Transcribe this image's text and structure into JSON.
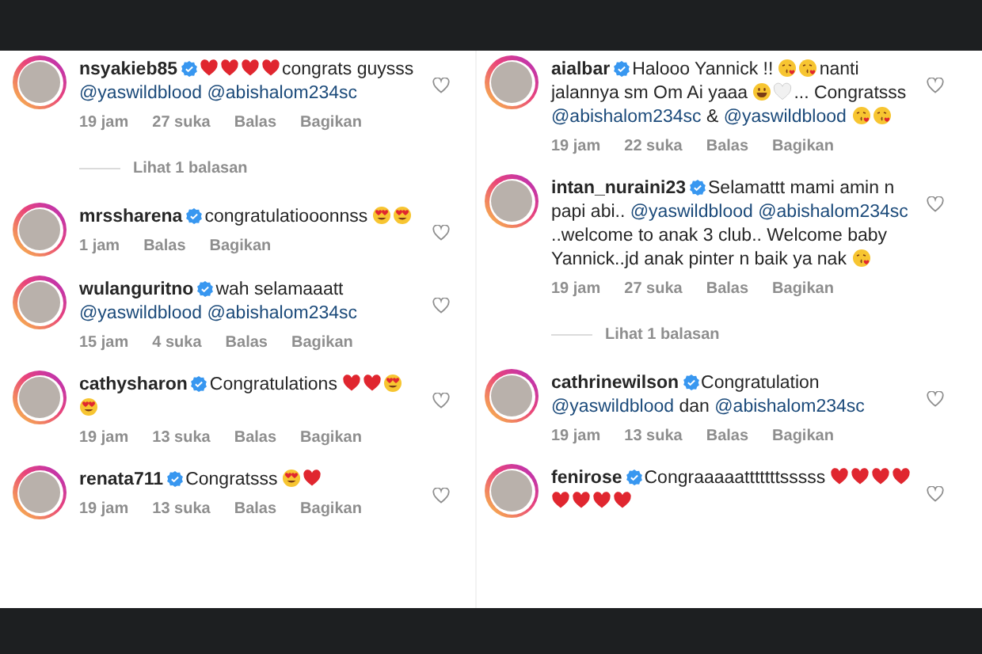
{
  "columns": [
    {
      "comments": [
        {
          "username": "nsyakieb85",
          "verified": true,
          "content": [
            {
              "kind": "heart"
            },
            {
              "kind": "heart"
            },
            {
              "kind": "heart"
            },
            {
              "kind": "heart"
            },
            {
              "kind": "text",
              "text": "congrats guysss"
            },
            {
              "kind": "mention",
              "text": "@yaswildblood"
            },
            {
              "kind": "mention",
              "text": "@abishalom234sc"
            }
          ],
          "time": "19 jam",
          "likes": "27 suka",
          "reply": "Balas",
          "share": "Bagikan",
          "replies": "Lihat 1 balasan"
        },
        {
          "username": "mrssharena",
          "verified": true,
          "content": [
            {
              "kind": "text",
              "text": "congratulatiooonnss"
            },
            {
              "kind": "heart-eyes"
            },
            {
              "kind": "heart-eyes"
            }
          ],
          "time": "1 jam",
          "reply": "Balas",
          "share": "Bagikan"
        },
        {
          "username": "wulanguritno",
          "verified": true,
          "content": [
            {
              "kind": "text",
              "text": "wah selamaaatt"
            },
            {
              "kind": "mention",
              "text": "@yaswildblood"
            },
            {
              "kind": "mention",
              "text": "@abishalom234sc"
            }
          ],
          "time": "15 jam",
          "likes": "4 suka",
          "reply": "Balas",
          "share": "Bagikan"
        },
        {
          "username": "cathysharon",
          "verified": true,
          "content": [
            {
              "kind": "text",
              "text": "Congratulations"
            },
            {
              "kind": "heart"
            },
            {
              "kind": "heart"
            },
            {
              "kind": "heart-eyes"
            },
            {
              "kind": "heart-eyes"
            }
          ],
          "time": "19 jam",
          "likes": "13 suka",
          "reply": "Balas",
          "share": "Bagikan"
        },
        {
          "username": "renata711",
          "verified": true,
          "content": [
            {
              "kind": "text",
              "text": "Congratsss"
            },
            {
              "kind": "heart-eyes"
            },
            {
              "kind": "heart"
            }
          ],
          "time": "19 jam",
          "likes": "13 suka",
          "reply": "Balas",
          "share": "Bagikan"
        }
      ]
    },
    {
      "comments": [
        {
          "username": "aialbar",
          "verified": true,
          "content": [
            {
              "kind": "text",
              "text": "Halooo Yannick !!"
            },
            {
              "kind": "kiss"
            },
            {
              "kind": "kiss"
            },
            {
              "kind": "text",
              "text": "nanti jalannya sm Om Ai yaaa"
            },
            {
              "kind": "smile"
            },
            {
              "kind": "white-heart"
            },
            {
              "kind": "text",
              "text": "... Congratsss"
            },
            {
              "kind": "mention",
              "text": "@abishalom234sc"
            },
            {
              "kind": "text",
              "text": "&"
            },
            {
              "kind": "mention",
              "text": "@yaswildblood"
            },
            {
              "kind": "kiss"
            },
            {
              "kind": "kiss"
            }
          ],
          "time": "19 jam",
          "likes": "22 suka",
          "reply": "Balas",
          "share": "Bagikan"
        },
        {
          "username": "intan_nuraini23",
          "verified": true,
          "content": [
            {
              "kind": "text",
              "text": "Selamattt mami amin n papi abi.."
            },
            {
              "kind": "mention",
              "text": "@yaswildblood"
            },
            {
              "kind": "mention",
              "text": "@abishalom234sc"
            },
            {
              "kind": "text",
              "text": "..welcome to anak 3 club.. Welcome baby Yannick..jd anak pinter n baik ya nak"
            },
            {
              "kind": "kiss"
            }
          ],
          "time": "19 jam",
          "likes": "27 suka",
          "reply": "Balas",
          "share": "Bagikan",
          "replies": "Lihat 1 balasan"
        },
        {
          "username": "cathrinewilson",
          "verified": true,
          "content": [
            {
              "kind": "text",
              "text": "Congratulation"
            },
            {
              "kind": "mention",
              "text": "@yaswildblood"
            },
            {
              "kind": "text",
              "text": "dan"
            },
            {
              "kind": "mention",
              "text": "@abishalom234sc"
            }
          ],
          "time": "19 jam",
          "likes": "13 suka",
          "reply": "Balas",
          "share": "Bagikan"
        },
        {
          "username": "fenirose",
          "verified": true,
          "content": [
            {
              "kind": "text",
              "text": "Congraaaaatttttttsssss"
            },
            {
              "kind": "heart"
            },
            {
              "kind": "heart"
            },
            {
              "kind": "heart"
            },
            {
              "kind": "heart"
            },
            {
              "kind": "heart"
            },
            {
              "kind": "heart"
            },
            {
              "kind": "heart"
            },
            {
              "kind": "heart"
            }
          ]
        }
      ]
    }
  ]
}
